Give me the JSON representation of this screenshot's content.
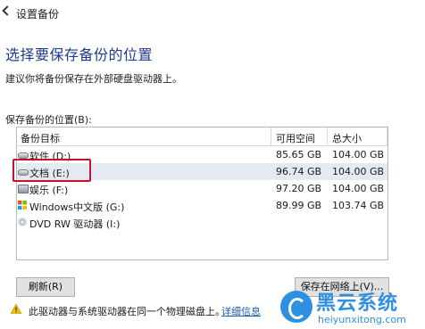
{
  "window": {
    "title": "设置备份"
  },
  "heading": "选择要保存备份的位置",
  "description": "建议你将备份保存在外部硬盘驱动器上。",
  "location_label": "保存备份的位置(B):",
  "table": {
    "headers": {
      "target": "备份目标",
      "free": "可用空间",
      "total": "总大小"
    },
    "rows": [
      {
        "name": "软件 (D:)",
        "free": "85.65 GB",
        "total": "104.00 GB",
        "icon": "drive-icon"
      },
      {
        "name": "文档 (E:)",
        "free": "96.74 GB",
        "total": "104.00 GB",
        "icon": "drive-icon",
        "selected": true
      },
      {
        "name": "娱乐 (F:)",
        "free": "97.20 GB",
        "total": "104.00 GB",
        "icon": "drive-icon"
      },
      {
        "name": "Windows中文版 (G:)",
        "free": "89.99 GB",
        "total": "103.74 GB",
        "icon": "windows-drive-icon"
      },
      {
        "name": "DVD RW 驱动器 (I:)",
        "free": "",
        "total": "",
        "icon": "dvd-drive-icon"
      }
    ]
  },
  "buttons": {
    "refresh": "刷新(R)",
    "save_network": "保存在网络上(V)..."
  },
  "warning": {
    "text": "此驱动器与系统驱动器在同一个物理磁盘上。",
    "link": "详细信息"
  },
  "watermark": {
    "name": "黑云系统",
    "url": "heiyunxitong.com"
  },
  "colors": {
    "accent": "#1e3a8a",
    "highlight_border": "#c8102e",
    "selected_row": "#e4e9f2",
    "watermark": "#2f8fe0"
  }
}
